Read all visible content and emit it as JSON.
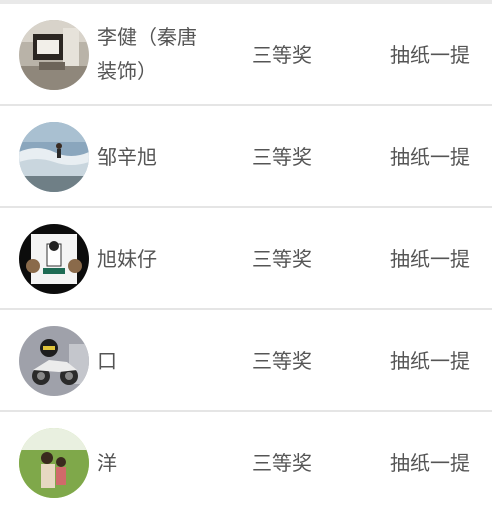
{
  "winners": [
    {
      "name": "李健（秦唐装饰）",
      "prize": "三等奖",
      "method": "抽纸一提",
      "avatar_icon": "room-photo-avatar"
    },
    {
      "name": "邹辛旭",
      "prize": "三等奖",
      "method": "抽纸一提",
      "avatar_icon": "beach-wave-avatar"
    },
    {
      "name": "旭妹仔",
      "prize": "三等奖",
      "method": "抽纸一提",
      "avatar_icon": "cartoon-figures-avatar"
    },
    {
      "name": "口",
      "prize": "三等奖",
      "method": "抽纸一提",
      "avatar_icon": "motorcycle-avatar"
    },
    {
      "name": "洋",
      "prize": "三等奖",
      "method": "抽纸一提",
      "avatar_icon": "outdoor-people-avatar"
    }
  ]
}
